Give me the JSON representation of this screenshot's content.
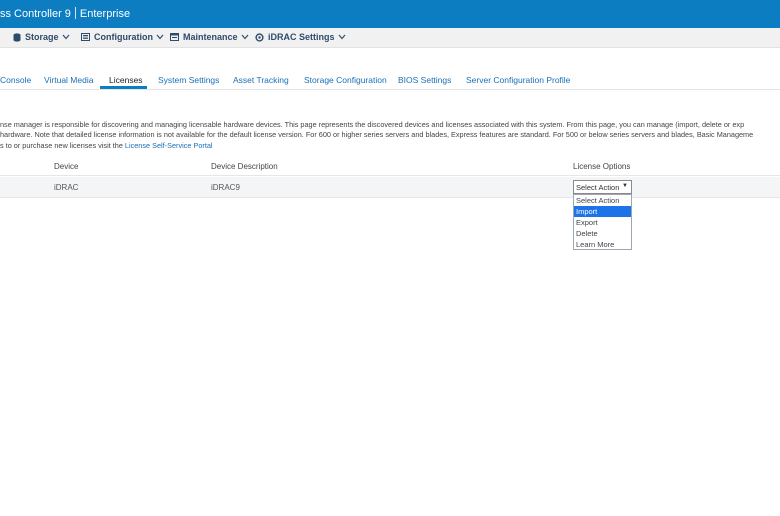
{
  "header": {
    "product": "ss Controller 9",
    "edition": "Enterprise"
  },
  "nav": {
    "items": [
      {
        "label": "Storage",
        "icon": "storage-icon"
      },
      {
        "label": "Configuration",
        "icon": "configuration-icon"
      },
      {
        "label": "Maintenance",
        "icon": "maintenance-icon"
      },
      {
        "label": "iDRAC Settings",
        "icon": "settings-icon"
      }
    ]
  },
  "tabs": {
    "items": [
      "Console",
      "Virtual Media",
      "Licenses",
      "System Settings",
      "Asset Tracking",
      "Storage Configuration",
      "BIOS Settings",
      "Server Configuration Profile"
    ],
    "active": "Licenses"
  },
  "description": {
    "line1": "nse manager is responsible for discovering and managing licensable hardware devices. This page represents the discovered devices and licenses associated with this system. From this page, you can manage (import, delete or exp",
    "line2": "hardware. Note that detailed license information is not available for the default license version. For 600 or higher series servers and blades, Express features are standard. For 500 or below series servers and blades, Basic Manageme",
    "line3_prefix": "s to or purchase new licenses visit the ",
    "line3_link": "License Self-Service Portal"
  },
  "table": {
    "headers": [
      "Device",
      "Device Description",
      "License Options"
    ],
    "rows": [
      {
        "device": "iDRAC",
        "description": "iDRAC9"
      }
    ]
  },
  "license_options": {
    "selected": "Select Action",
    "options": [
      "Select Action",
      "Import",
      "Export",
      "Delete",
      "Learn More"
    ],
    "highlighted": "Import"
  },
  "colors": {
    "header_blue": "#0b7dc0",
    "link_blue": "#1a6fb5",
    "highlight": "#1e73e8"
  }
}
